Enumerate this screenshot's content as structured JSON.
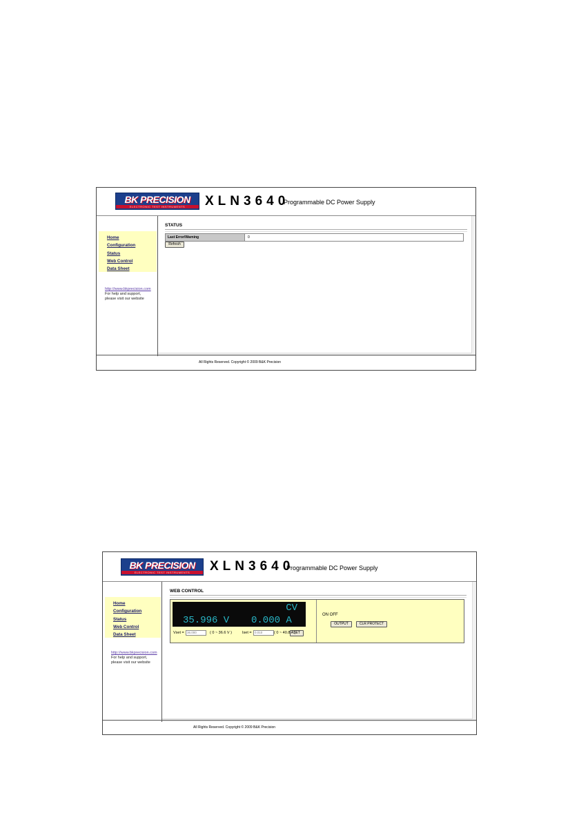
{
  "brand": {
    "logo_text": "BK PRECISION",
    "logo_subtext": "ELECTRONIC TEST INSTRUMENTS",
    "model": "XLN3640",
    "subtitle": "Programmable DC Power Supply",
    "colors": {
      "logo_blue": "#1c3f8c",
      "logo_red": "#c8102e",
      "nav_bg": "#ffffc0"
    }
  },
  "nav": {
    "items": [
      "Home",
      "Configuration",
      "Status",
      "Web Control",
      "Data Sheet"
    ]
  },
  "sidebar": {
    "link": "http://www.bkprecision.com",
    "help_line1": "For help and support,",
    "help_line2": "please visit our website"
  },
  "footer": {
    "text": "All Rights Reserved. Copyright © 2009 B&K Precision"
  },
  "status_page": {
    "title": "STATUS",
    "field_label": "Last Error/Warning",
    "field_value": "0",
    "refresh_label": "Refresh"
  },
  "web_control": {
    "title": "WEB CONTROL",
    "display_mode": "CV",
    "display_voltage": "35.996 V",
    "display_current": "0.000 A",
    "vset_label": "Vset =",
    "vset_value": "36.000",
    "vset_range": "( 0 ~ 36.6 V )",
    "iset_label": "Iset =",
    "iset_value": "0.010",
    "iset_range": "( 0 ~ 40.8 A )",
    "set_label": "SET",
    "on_off_label": "ON OFF",
    "output_label": "OUTPUT",
    "clr_protect_label": "CLR PROTECT"
  }
}
